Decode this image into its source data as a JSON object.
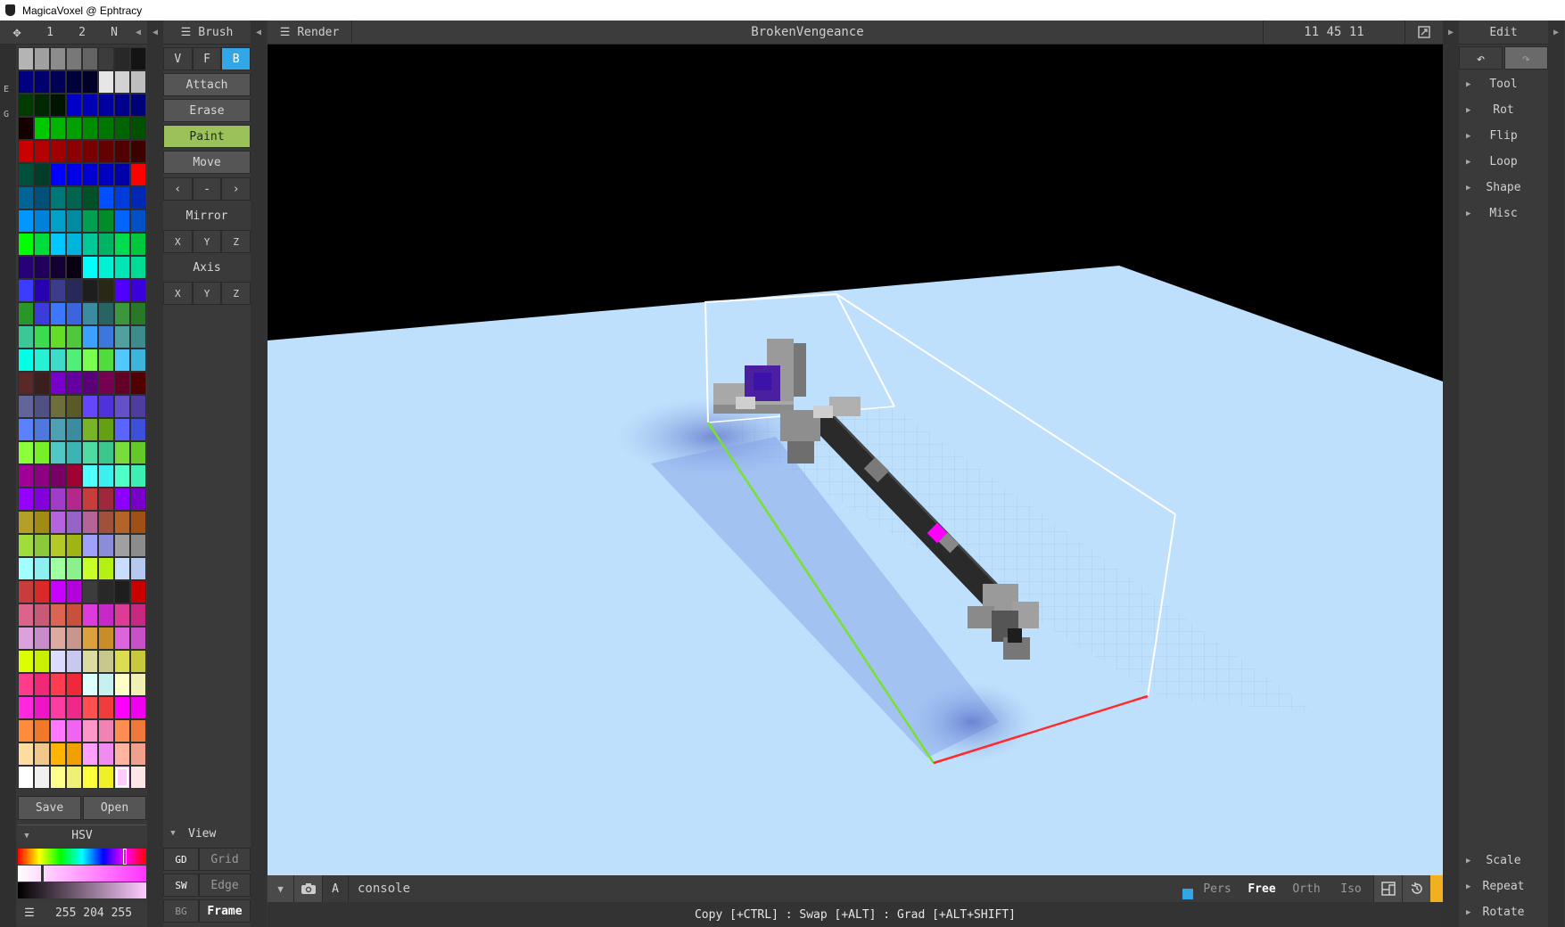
{
  "window": {
    "title": "MagicaVoxel @ Ephtracy"
  },
  "palette_header": {
    "tabs": [
      "1",
      "2",
      "N"
    ]
  },
  "left_gutter": {
    "letters": [
      "E",
      "G"
    ]
  },
  "brush": {
    "title": "Brush",
    "modes": [
      "V",
      "F",
      "B"
    ],
    "actions": [
      "Attach",
      "Erase",
      "Paint",
      "Move"
    ],
    "nav": [
      "‹",
      "-",
      "›"
    ],
    "mirror_label": "Mirror",
    "axis_label": "Axis",
    "xyz": [
      "X",
      "Y",
      "Z"
    ]
  },
  "render_tab": {
    "title": "Render"
  },
  "document": {
    "name": "BrokenVengeance",
    "dims": "11 45 11"
  },
  "edit": {
    "title": "Edit",
    "items": [
      "Tool",
      "Rot",
      "Flip",
      "Loop",
      "Shape",
      "Misc"
    ],
    "bottom_items": [
      "Scale",
      "Repeat",
      "Rotate"
    ]
  },
  "palette_footer": {
    "save": "Save",
    "open": "Open",
    "hsv": "HSV",
    "rgb": "255 204 255"
  },
  "view": {
    "title": "View",
    "rows": [
      {
        "key": "GD",
        "label": "Grid"
      },
      {
        "key": "SW",
        "label": "Edge"
      },
      {
        "key": "BG",
        "label": "Frame"
      }
    ]
  },
  "bottom": {
    "a_label": "A",
    "console": "console",
    "camera_modes": [
      "Pers",
      "Free",
      "Orth",
      "Iso"
    ],
    "active_camera": "Free"
  },
  "status": {
    "text": "Copy [+CTRL] : Swap [+ALT] : Grad [+ALT+SHIFT]"
  },
  "colors": {
    "accent_blue": "#33a6e8",
    "paint_green": "#9bc25a",
    "ground": "#bfe0fc",
    "axis_x": "#ff2b2b",
    "axis_y": "#7be02e"
  },
  "palette": [
    "#b4b4b4",
    "#a0a0a0",
    "#8c8c8c",
    "#787878",
    "#646464",
    "#3c3c3c",
    "#282828",
    "#141414",
    "#000080",
    "#00006e",
    "#000056",
    "#00003a",
    "#000028",
    "#e6e6e6",
    "#d2d2d2",
    "#bebebe",
    "#003c00",
    "#002800",
    "#001400",
    "#0000c8",
    "#0000b4",
    "#0000a0",
    "#00008c",
    "#000078",
    "#140000",
    "#00c800",
    "#00b400",
    "#00a000",
    "#008c00",
    "#007800",
    "#006400",
    "#005000",
    "#c80000",
    "#b40000",
    "#a00000",
    "#8c0000",
    "#780000",
    "#640000",
    "#500000",
    "#3c0000",
    "#00503c",
    "#003c28",
    "#0000ff",
    "#0000e6",
    "#0000d2",
    "#0000be",
    "#0000aa",
    "#ff0000",
    "#006496",
    "#005078",
    "#007878",
    "#006450",
    "#005028",
    "#0050ff",
    "#003cdc",
    "#0028b4",
    "#0096ff",
    "#0082dc",
    "#00a0c8",
    "#008ca0",
    "#00a050",
    "#008c28",
    "#0064ff",
    "#0050c8",
    "#00ff00",
    "#00dc3c",
    "#00c8ff",
    "#00b4dc",
    "#00c896",
    "#00b464",
    "#00dc50",
    "#00c83c",
    "#280078",
    "#1e005a",
    "#140032",
    "#0a0014",
    "#00ffff",
    "#00f0d2",
    "#00e6b4",
    "#00dc96",
    "#3c3cff",
    "#2800b4",
    "#3c3c8c",
    "#28285a",
    "#1e1e1e",
    "#282814",
    "#5000ff",
    "#3c00dc",
    "#289628",
    "#3c3cdc",
    "#3c78ff",
    "#3c64dc",
    "#3c8ca0",
    "#286464",
    "#3c963c",
    "#287828",
    "#3cc896",
    "#3cdc50",
    "#64dc28",
    "#50c83c",
    "#3ca0ff",
    "#3c78dc",
    "#50a0a0",
    "#3c8c8c",
    "#00ffe6",
    "#28f0d2",
    "#3cdcc8",
    "#50f078",
    "#78ff50",
    "#50dc3c",
    "#50c8ff",
    "#3cb4dc",
    "#5a2828",
    "#3c1e1e",
    "#7800c8",
    "#6400a0",
    "#5a0078",
    "#780050",
    "#640028",
    "#500000",
    "#64649c",
    "#505082",
    "#6e6e3c",
    "#5a5a28",
    "#6446ff",
    "#5032dc",
    "#6450c8",
    "#503ca0",
    "#5a82ff",
    "#5078dc",
    "#50a0b4",
    "#3c8ca0",
    "#78b428",
    "#64a014",
    "#5a64ff",
    "#3c50dc",
    "#8cff3c",
    "#78f028",
    "#50c8c8",
    "#3cb4b4",
    "#50dca0",
    "#3cc88c",
    "#78dc3c",
    "#64c828",
    "#a00096",
    "#8c0082",
    "#780064",
    "#a00032",
    "#50ffff",
    "#3cf0f0",
    "#50ffc8",
    "#3cf0b4",
    "#9600ff",
    "#8200dc",
    "#a03cc8",
    "#b4288c",
    "#c83c3c",
    "#a0283c",
    "#8c00ff",
    "#7800c8",
    "#b4a028",
    "#a08c14",
    "#b464dc",
    "#9664c8",
    "#b46496",
    "#a0503c",
    "#b46428",
    "#a05014",
    "#a0dc3c",
    "#8cc83c",
    "#b4c828",
    "#a0b414",
    "#a0a0ff",
    "#8c8cdc",
    "#a0a0a0",
    "#8c8c8c",
    "#a0ffff",
    "#8cf0f0",
    "#a0ffa0",
    "#8cf08c",
    "#c8ff28",
    "#b4f014",
    "#c8dcff",
    "#b4c8f0",
    "#c83c3c",
    "#dc2828",
    "#c800ff",
    "#b400dc",
    "#3c3c3c",
    "#282828",
    "#1e1e1e",
    "#c80000",
    "#dc648c",
    "#c85a78",
    "#dc6450",
    "#c8503c",
    "#dc3cdc",
    "#c828c8",
    "#dc3c96",
    "#c82882",
    "#dca0dc",
    "#c88cc8",
    "#dcaaa0",
    "#c8968c",
    "#dca03c",
    "#c88c28",
    "#dc64dc",
    "#c850c8",
    "#dcff00",
    "#c8f000",
    "#dcdcff",
    "#c8c8f0",
    "#dcdca0",
    "#c8c88c",
    "#dcdc50",
    "#c8c83c",
    "#ff3c8c",
    "#f02878",
    "#ff3c50",
    "#f0283c",
    "#dcffff",
    "#c8f0f0",
    "#ffffc8",
    "#f0f0b4",
    "#ff28dc",
    "#f014c8",
    "#ff3ca0",
    "#f0288c",
    "#ff5050",
    "#f03c3c",
    "#ff00ff",
    "#f000f0",
    "#ff8c3c",
    "#f07828",
    "#ff78ff",
    "#f064f0",
    "#ff96c8",
    "#f082b4",
    "#ff8c50",
    "#f0783c",
    "#ffdca0",
    "#f0c88c",
    "#ffb400",
    "#f0a000",
    "#ffa0ff",
    "#f08cf0",
    "#ffb4a0",
    "#f0a08c",
    "#ffffff",
    "#f0f0f0",
    "#ffff8c",
    "#f0f078",
    "#ffff3c",
    "#f0f028",
    "#ffccff",
    "#ffe6e6"
  ]
}
